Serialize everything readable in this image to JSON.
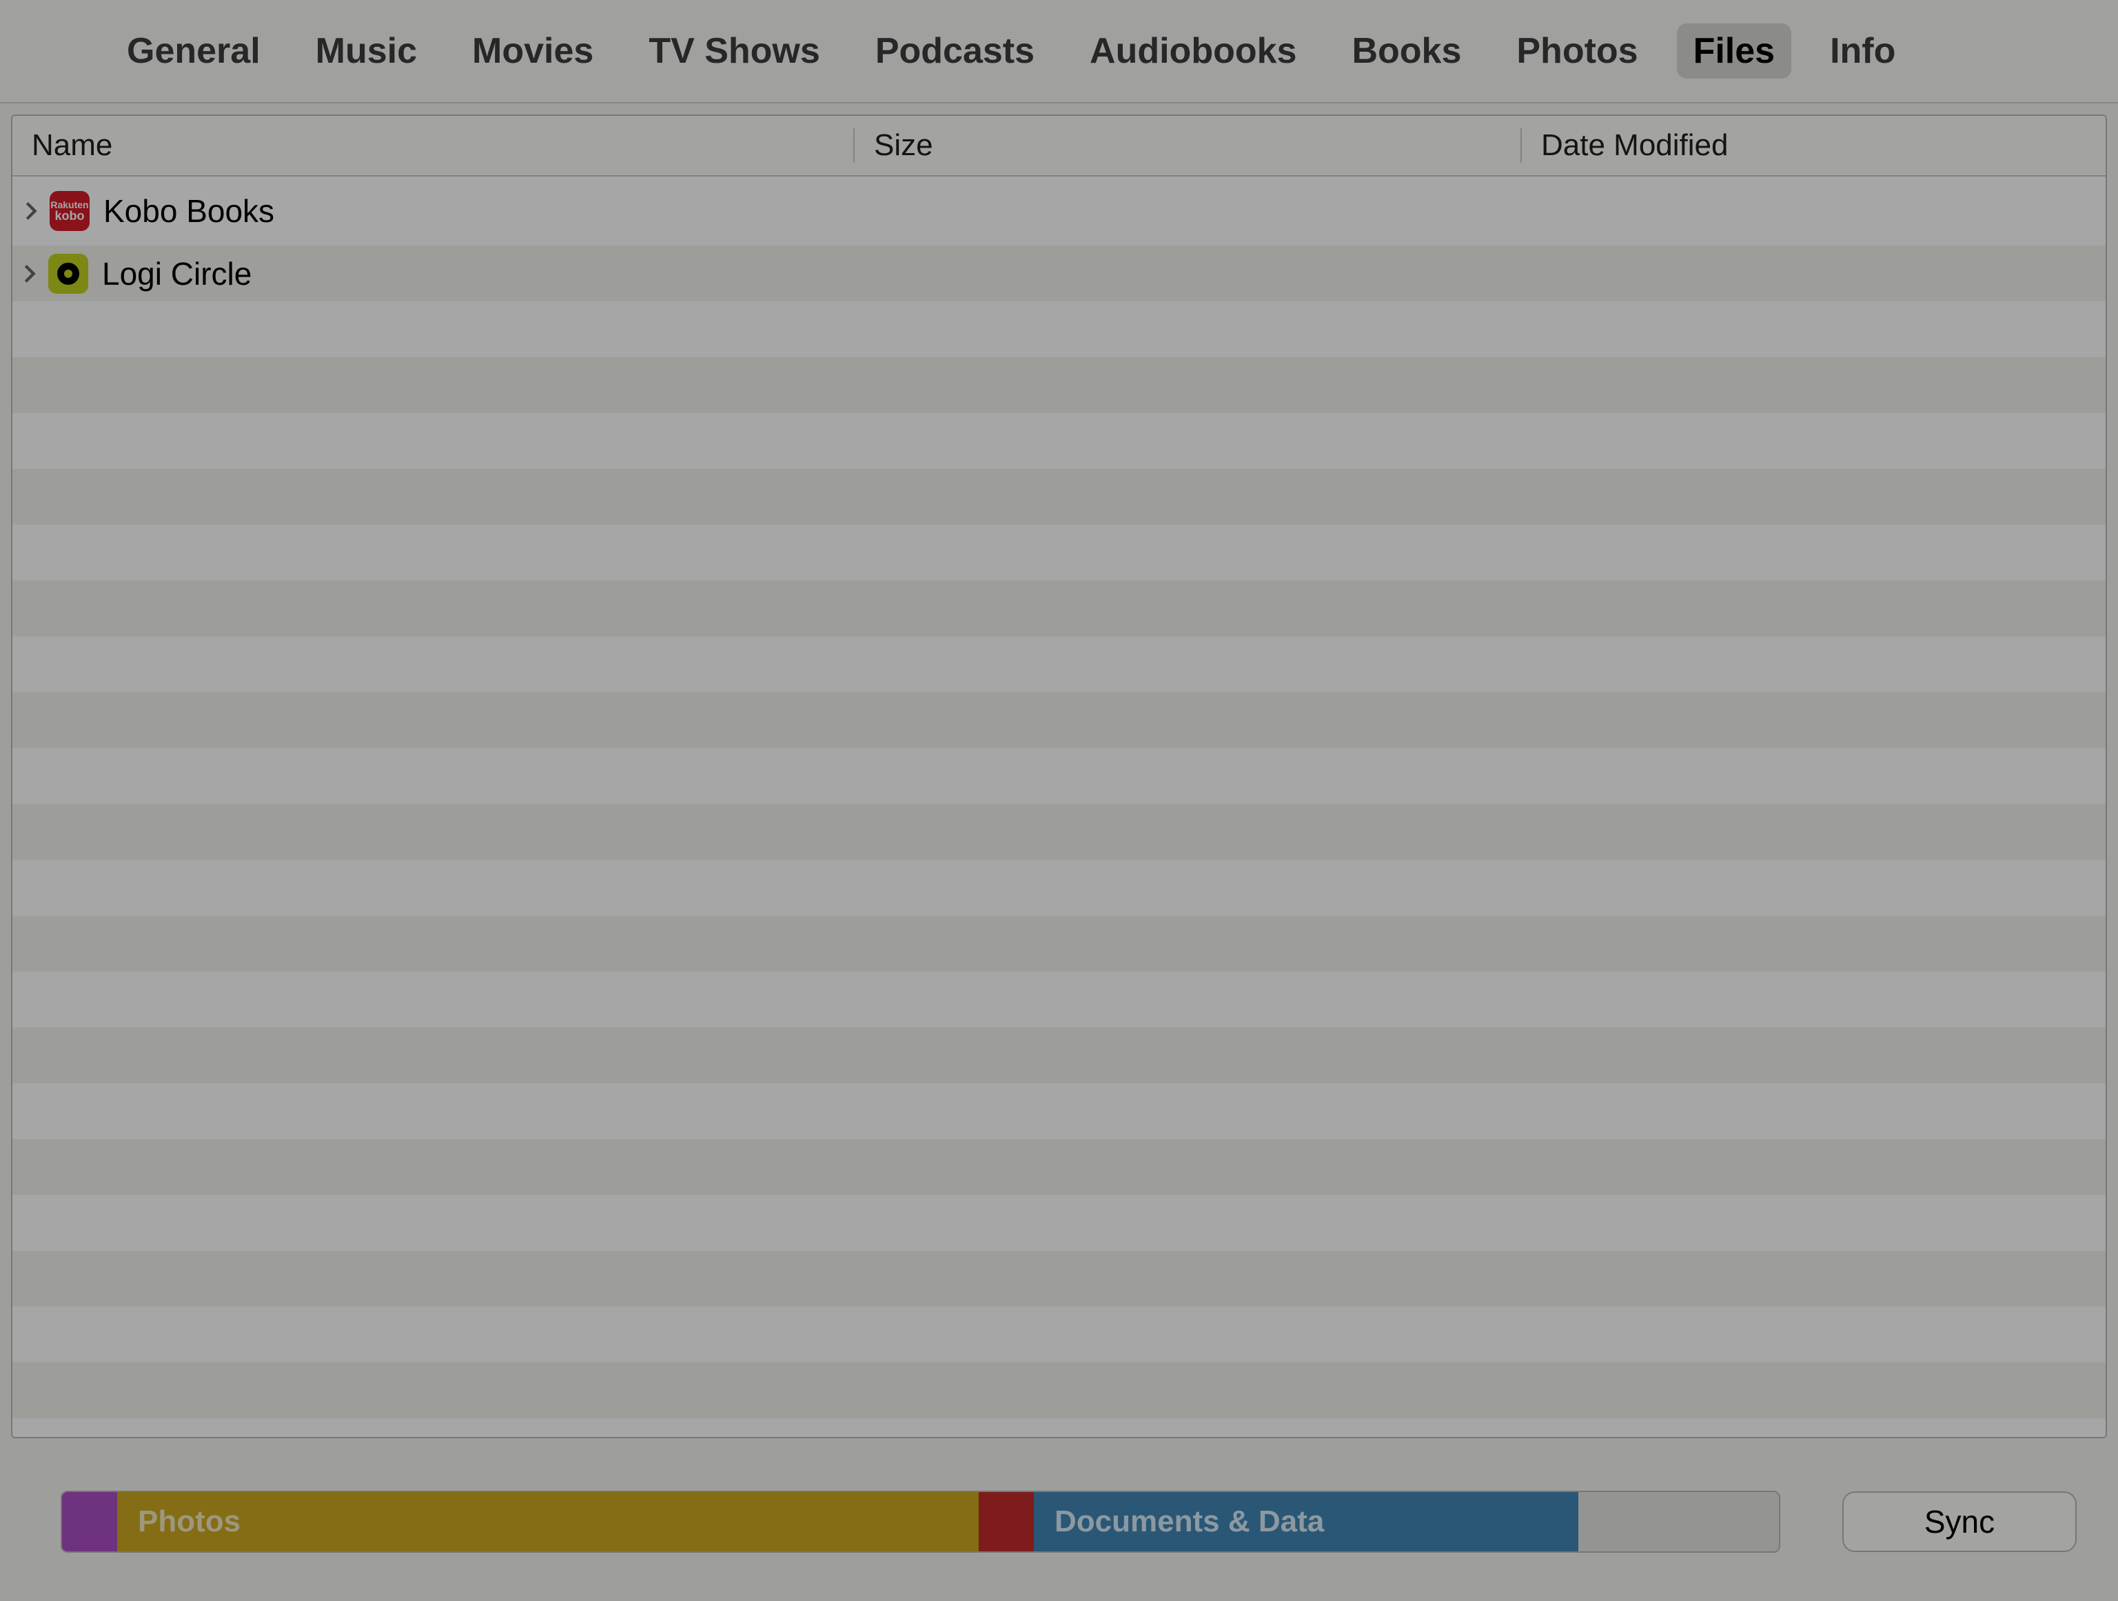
{
  "tabs": [
    {
      "label": "General",
      "active": false
    },
    {
      "label": "Music",
      "active": false
    },
    {
      "label": "Movies",
      "active": false
    },
    {
      "label": "TV Shows",
      "active": false
    },
    {
      "label": "Podcasts",
      "active": false
    },
    {
      "label": "Audiobooks",
      "active": false
    },
    {
      "label": "Books",
      "active": false
    },
    {
      "label": "Photos",
      "active": false
    },
    {
      "label": "Files",
      "active": true
    },
    {
      "label": "Info",
      "active": false
    }
  ],
  "columns": {
    "name": "Name",
    "size": "Size",
    "date": "Date Modified"
  },
  "files": [
    {
      "name": "Kobo Books",
      "icon": "kobo",
      "size": "",
      "date": "",
      "highlighted": true
    },
    {
      "name": "Logi Circle",
      "icon": "logi",
      "size": "",
      "date": "",
      "highlighted": false
    }
  ],
  "storage": {
    "photos_label": "Photos",
    "docs_label": "Documents & Data"
  },
  "sync_label": "Sync",
  "icon_text": {
    "kobo_line1": "Rakuten",
    "kobo_line2": "kobo"
  }
}
